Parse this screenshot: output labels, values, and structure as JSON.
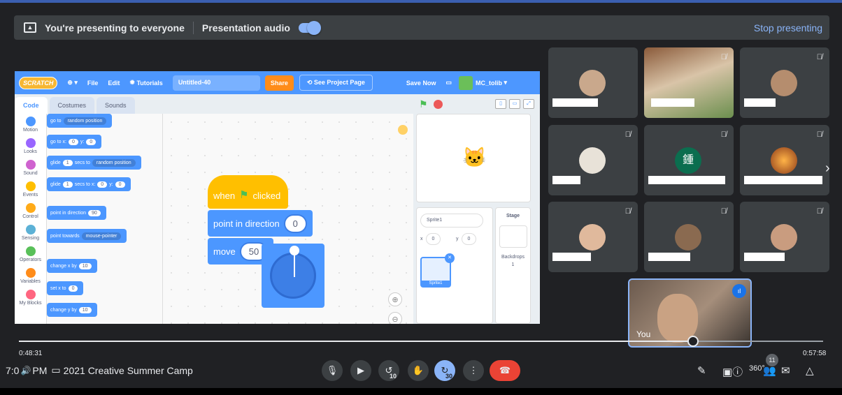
{
  "presenting_bar": {
    "status": "You're presenting to everyone",
    "audio_label": "Presentation audio",
    "stop_label": "Stop presenting"
  },
  "scratch": {
    "logo": "SCRATCH",
    "menu": [
      "File",
      "Edit",
      "Tutorials"
    ],
    "project_title": "Untitled-40",
    "share": "Share",
    "see_project": "See Project Page",
    "save_now": "Save Now",
    "username": "MC_tolib",
    "tabs": [
      "Code",
      "Costumes",
      "Sounds"
    ],
    "categories": [
      {
        "label": "Motion",
        "color": "#4c97ff"
      },
      {
        "label": "Looks",
        "color": "#9966ff"
      },
      {
        "label": "Sound",
        "color": "#cf63cf"
      },
      {
        "label": "Events",
        "color": "#ffbf00"
      },
      {
        "label": "Control",
        "color": "#ffab19"
      },
      {
        "label": "Sensing",
        "color": "#5cb1d6"
      },
      {
        "label": "Operators",
        "color": "#59c059"
      },
      {
        "label": "Variables",
        "color": "#ff8c1a"
      },
      {
        "label": "My Blocks",
        "color": "#ff6680"
      }
    ],
    "palette": {
      "goto_prefix": "go to",
      "goto_value": "random position",
      "gotoxy_prefix": "go to x:",
      "gotoxy_x": "0",
      "gotoxy_y_label": "y:",
      "gotoxy_y": "0",
      "glide1_prefix": "glide",
      "glide1_secs": "1",
      "glide1_mid": "secs to",
      "glide1_value": "random position",
      "glide2_prefix": "glide",
      "glide2_secs": "1",
      "glide2_mid": "secs to x:",
      "glide2_x": "0",
      "glide2_y_label": "y:",
      "glide2_y": "0",
      "point_dir_prefix": "point in direction",
      "point_dir_value": "90",
      "point_towards_prefix": "point towards",
      "point_towards_value": "mouse-pointer",
      "change_x_prefix": "change x by",
      "change_x_value": "10",
      "set_x_prefix": "set x to",
      "set_x_value": "0",
      "change_y_prefix": "change y by",
      "change_y_value": "10"
    },
    "script": {
      "hat_when": "when",
      "hat_clicked": "clicked",
      "point_label": "point in direction",
      "point_value": "0",
      "move_label": "move",
      "move_value": "50"
    },
    "sprite_panel": {
      "sprite_name": "Sprite1",
      "x_label": "x",
      "x_value": "0",
      "y_label": "y",
      "y_value": "0",
      "tile_label": "Sprite1",
      "stage_label": "Stage",
      "backdrops_label": "Backdrops",
      "backdrops_count": "1"
    }
  },
  "participants": {
    "initial": "鍾",
    "self_name": "You"
  },
  "playback": {
    "current": "0:48:31",
    "total": "0:57:58",
    "progress": 0.838
  },
  "bottom": {
    "time": "7:0",
    "time_tail": "PM",
    "meeting_title": "2021 Creative Summer Camp",
    "rewind_seconds": "10",
    "forward_seconds": "30",
    "participant_count": "11"
  }
}
